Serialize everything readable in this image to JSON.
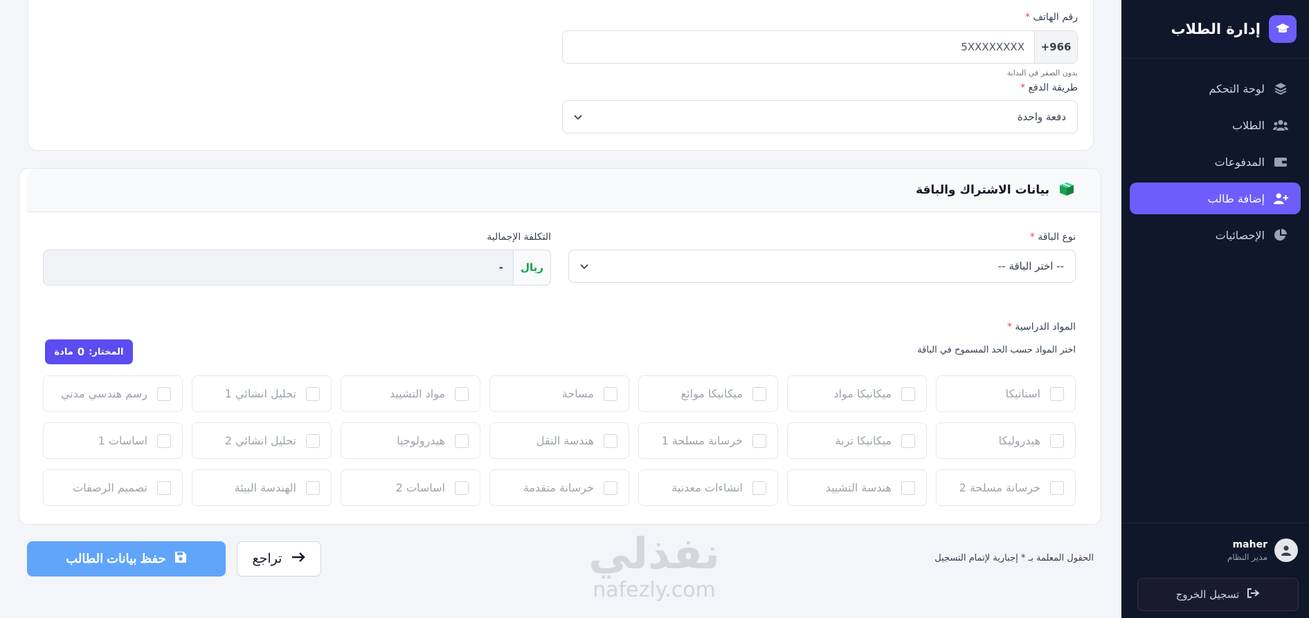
{
  "sidebar": {
    "brand_title": "إدارة الطلاب",
    "brand_icon": "graduation-cap-icon",
    "items": [
      {
        "label": "لوحة التحكم",
        "icon": "layers-icon",
        "active": false
      },
      {
        "label": "الطلاب",
        "icon": "users-icon",
        "active": false
      },
      {
        "label": "المدفوعات",
        "icon": "wallet-icon",
        "active": false
      },
      {
        "label": "إضافة طالب",
        "icon": "user-plus-icon",
        "active": true
      },
      {
        "label": "الإحصائيات",
        "icon": "pie-chart-icon",
        "active": false
      }
    ],
    "user": {
      "name": "maher",
      "role": "مدير النظام"
    },
    "logout_label": "تسجيل الخروج"
  },
  "contact": {
    "phone_label": "رقم الهاتف",
    "phone_prefix": "966+",
    "phone_placeholder": "5XXXXXXXX",
    "phone_hint": "بدون الصفر في البداية",
    "payment_label": "طريقة الدفع",
    "payment_value": "دفعة واحدة"
  },
  "subscription": {
    "title": "بيانات الاشتراك والباقة",
    "package_label": "نوع الباقة",
    "package_value": "-- اختر الباقة --",
    "cost_label": "التكلفة الإجمالية",
    "cost_currency": "ريال",
    "cost_value": "-",
    "subjects_label": "المواد الدراسية",
    "subjects_hint": "اختر المواد حسب الحد المسموح في الباقة",
    "selected_prefix": "المختار:",
    "selected_count": "0",
    "selected_suffix": "مادة",
    "subjects": [
      [
        "استاتيكا",
        "ميكانيكا مواد",
        "ميكانيكا موائع",
        "مساحة",
        "مواد التشييد",
        "تحليل انشائي 1",
        "رسم هندسي مدني"
      ],
      [
        "هيدروليكا",
        "ميكانيكا تربة",
        "خرسانة مسلحة 1",
        "هندسة النقل",
        "هيدرولوجيا",
        "تحليل انشائي 2",
        "اساسات 1"
      ],
      [
        "خرسانة مسلحة 2",
        "هندسة التشييد",
        "انشاءات معدنية",
        "خرسانة متقدمة",
        "اساسات 2",
        "الهندسة البيئة",
        "تصميم الرصفات"
      ]
    ]
  },
  "footer": {
    "required_note": "الحقول المعلمة بـ * إجبارية لإتمام التسجيل",
    "back_label": "تراجع",
    "save_label": "حفظ بيانات الطالب"
  },
  "watermark": {
    "arabic": "نفذلي",
    "latin": "nafezly.com"
  },
  "colors": {
    "accent": "#6d5dfc",
    "sidebar_bg": "#0f172a",
    "save_button": "#60a5fa",
    "required": "#ef4444"
  }
}
